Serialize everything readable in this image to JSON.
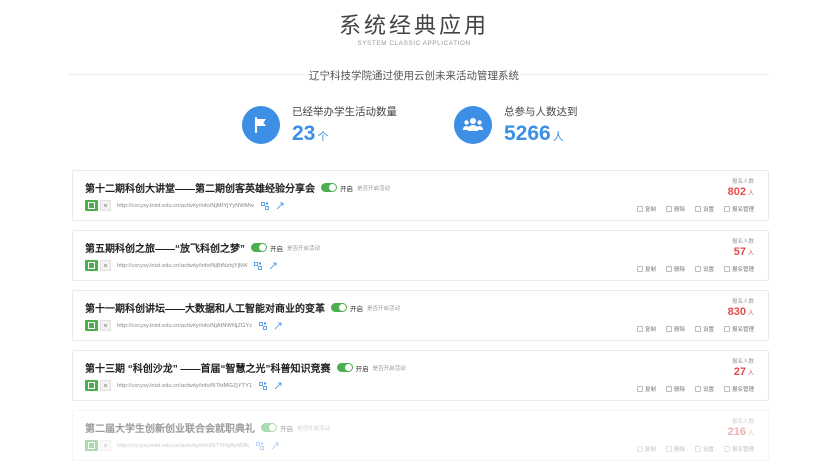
{
  "header": {
    "title": "系统经典应用",
    "subtitle": "SYSTEM CLASSIC APPLICATION",
    "school_line": "辽宁科技学院通过使用云创未来活动管理系统"
  },
  "stats": [
    {
      "label": "已经举办学生活动数量",
      "value": "23",
      "unit": "个",
      "icon": "flag-icon"
    },
    {
      "label": "总参与人数达到",
      "value": "5266",
      "unit": "人",
      "icon": "people-icon"
    }
  ],
  "colors": {
    "accent": "#3d8fe6",
    "toggle_green": "#4cae4f",
    "count_red": "#e24d4d"
  },
  "activity_labels": {
    "toggle_on": "开启",
    "toggle_hint": "是否开启活动",
    "count_label": "报名人数",
    "count_unit": "人",
    "copy": "复制",
    "delete": "删除",
    "settings": "设置",
    "manage": "报名管理"
  },
  "activities": [
    {
      "title": "第十二期科创大讲堂——第二期创客英雄经验分享会",
      "url": "http://cxcyxy.lnist.edu.cn/activity/info/NjMtYjYyNWMw",
      "count": "802"
    },
    {
      "title": "第五期科创之旅——“放飞科创之梦”",
      "url": "http://cxcyxy.lnist.edu.cn/activity/info/NjBtNzhjYjM4",
      "count": "57"
    },
    {
      "title": "第十一期科创讲坛——大数据和人工智能对商业的变革",
      "url": "http://cxcyxy.lnist.edu.cn/activity/info/NjAtNWNjZGYz",
      "count": "830"
    },
    {
      "title": "第十三期 “科创沙龙” ——首届“智慧之光”科普知识竞赛",
      "url": "http://cxcyxy.lnist.edu.cn/activity/info/NTktMGZjYTY1",
      "count": "27"
    },
    {
      "title": "第二届大学生创新创业联合会就职典礼",
      "url": "http://cxcyxy.lnist.edu.cn/activity/info/NTYtNjAyNDlk",
      "count": "216"
    }
  ]
}
